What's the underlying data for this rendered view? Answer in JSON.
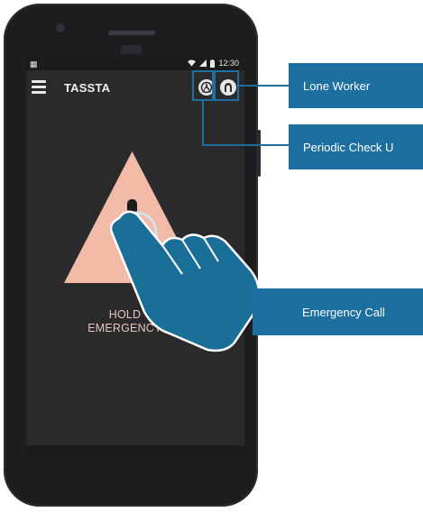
{
  "status_bar": {
    "left_icon": "notification-icon",
    "time": "12:30"
  },
  "app_bar": {
    "title": "TASSTA",
    "icons": [
      "periodic-check-icon",
      "lone-worker-icon"
    ]
  },
  "emergency": {
    "line1": "HOLD TO",
    "line2": "EMERGENCY CA"
  },
  "callouts": {
    "lone_worker": "Lone Worker",
    "periodic_check": "Periodic Check U",
    "emergency_call": "Emergency Call"
  },
  "colors": {
    "callout": "#1d6fa0",
    "warning_triangle": "#f1bba8",
    "screen": "#2a2a2d"
  }
}
